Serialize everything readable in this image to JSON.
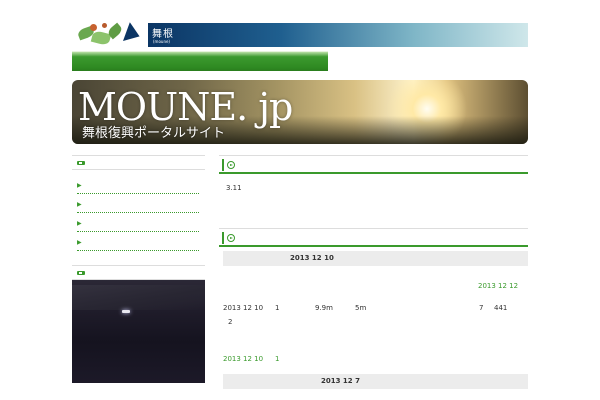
{
  "header": {
    "site_name": "舞根",
    "site_roman": "(moune)"
  },
  "banner": {
    "title": "MOUNE. jp",
    "subtitle": "舞根復興ポータルサイト"
  },
  "main": {
    "section1_text": "3.11",
    "post1": {
      "date_heading": "2013 12 10",
      "side_date": "2013 12 12",
      "body_date": "2013 12 10",
      "body_num1": "1",
      "body_depth": "9.9m",
      "body_height": "5m",
      "body_num2": "7",
      "body_num3": "441",
      "body_num4": "2",
      "footer_date": "2013 12 10",
      "footer_num": "1"
    },
    "post2": {
      "date_heading": "2013 12 7"
    }
  },
  "colors": {
    "accent_green": "#3a9a2c",
    "header_blue": "#0b3564"
  }
}
